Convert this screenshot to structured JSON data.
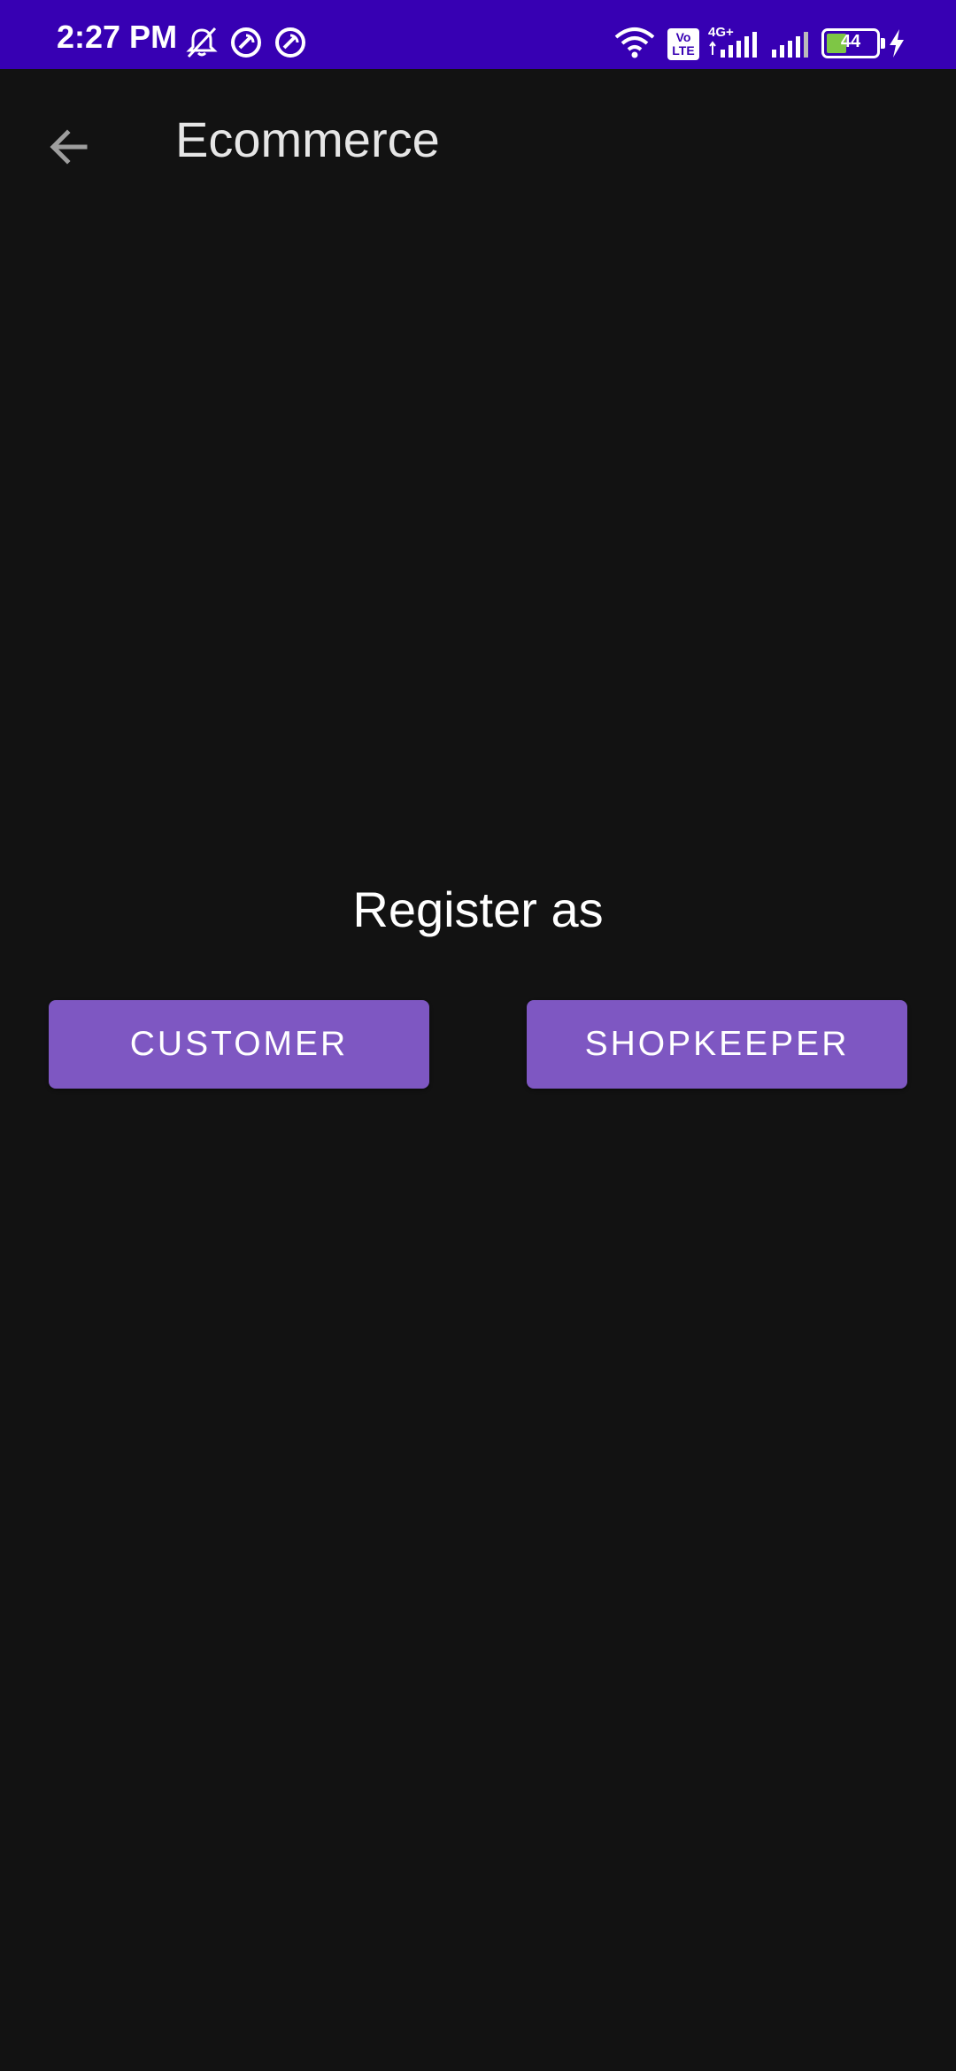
{
  "status_bar": {
    "time": "2:27 PM",
    "battery_level": "44",
    "network_type": "4G+",
    "volte_label": "Vo LTE",
    "background_color": "#3700b3",
    "icons": [
      "mute-bell-icon",
      "sync-icon",
      "sync-icon",
      "wifi-icon",
      "volte-icon",
      "signal-icon",
      "signal-icon",
      "battery-icon",
      "charging-icon"
    ]
  },
  "app_bar": {
    "title": "Ecommerce",
    "back_icon": "arrow-left-icon"
  },
  "main": {
    "register_label": "Register as",
    "buttons": {
      "customer": "CUSTOMER",
      "shopkeeper": "SHOPKEEPER"
    },
    "button_color": "#7e57c2",
    "background_color": "#121212"
  }
}
